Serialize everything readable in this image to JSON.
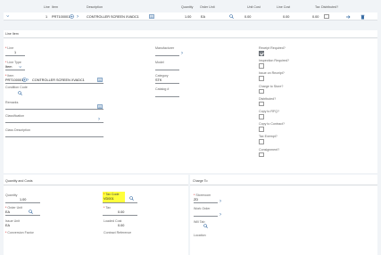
{
  "grid": {
    "headers": {
      "line": "Line",
      "item": "Item",
      "description": "Description",
      "quantity": "Quantity",
      "order_unit": "Order Unit",
      "unit_cost": "Unit Cost",
      "line_cost": "Line Cost",
      "tax": "Tax",
      "distributed": "Distributed?"
    },
    "row": {
      "line": "1",
      "item": "PRT100001",
      "description": "CONTROLLER SCREEN XVADC1",
      "quantity": "1.00",
      "order_unit": "EA",
      "unit_cost": "0.00",
      "line_cost": "0.00",
      "tax": "0.00"
    }
  },
  "line_item": {
    "section_title": "Line Item",
    "line_label": "Line",
    "line_value": "1",
    "line_type_label": "Line Type",
    "line_type_value": "Item",
    "item_label": "Item",
    "item_value": "PRT100001",
    "item_description": "CONTROLLER SCREEN XVADC1",
    "condition_code_label": "Condition Code",
    "remarks_label": "Remarks",
    "classification_label": "Classification",
    "class_description_label": "Class Description",
    "manufacturer_label": "Manufacturer",
    "model_label": "Model",
    "category_label": "Category",
    "category_value": "STK",
    "catalog_label": "Catalog #",
    "checkboxes": [
      {
        "label": "Receipt Required?",
        "checked": true
      },
      {
        "label": "Inspection Required?",
        "checked": false
      },
      {
        "label": "Issue on Receipt?",
        "checked": false
      },
      {
        "label": "Charge to Store?",
        "checked": false
      },
      {
        "label": "Distributed?",
        "checked": false
      },
      {
        "label": "Copy to RFQ?",
        "checked": false
      },
      {
        "label": "Copy to Contract?",
        "checked": false
      },
      {
        "label": "Tax Exempt?",
        "checked": false
      },
      {
        "label": "Consignment?",
        "checked": false
      }
    ]
  },
  "qty_costs": {
    "section_title": "Quantity and Costs",
    "quantity_label": "Quantity",
    "quantity_value": "1.00",
    "order_unit_label": "Order Unit",
    "order_unit_value": "EA",
    "issue_unit_label": "Issue Unit",
    "issue_unit_value": "EA",
    "conversion_label": "Conversion Factor",
    "tax_code_label": "Tax Code",
    "tax_code_value": "VD001",
    "tax_label": "Tax",
    "tax_value": "0.00",
    "loaded_cost_label": "Loaded Cost",
    "loaded_cost_value": "0.00",
    "contract_ref_label": "Contract Reference"
  },
  "charge_to": {
    "section_title": "Charge To",
    "storeroom_label": "Storeroom",
    "storeroom_value": "ZD",
    "work_order_label": "Work Order",
    "gl_tab_label": "Will Tab",
    "location_label": "Location"
  },
  "colors": {
    "accent": "#3a6ea5",
    "highlight": "#ffff3c",
    "panel": "#ffffff",
    "background": "#f1f4f7"
  }
}
